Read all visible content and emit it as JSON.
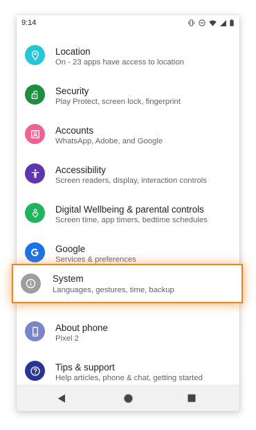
{
  "status_bar": {
    "time": "9:14",
    "icons": [
      "vibrate-icon",
      "do-not-disturb-icon",
      "wifi-icon",
      "signal-icon",
      "battery-icon"
    ]
  },
  "settings": {
    "items": [
      {
        "title": "Location",
        "subtitle": "On - 23 apps have access to location",
        "icon": "location-pin-icon",
        "color": "#26c6da"
      },
      {
        "title": "Security",
        "subtitle": "Play Protect, screen lock, fingerprint",
        "icon": "unlocked-padlock-icon",
        "color": "#1e8e3e"
      },
      {
        "title": "Accounts",
        "subtitle": "WhatsApp, Adobe, and Google",
        "icon": "account-box-icon",
        "color": "#f06292"
      },
      {
        "title": "Accessibility",
        "subtitle": "Screen readers, display, interaction controls",
        "icon": "accessibility-person-icon",
        "color": "#5e35b1"
      },
      {
        "title": "Digital Wellbeing & parental controls",
        "subtitle": "Screen time, app timers, bedtime schedules",
        "icon": "wellbeing-heart-icon",
        "color": "#1fb55a"
      },
      {
        "title": "Google",
        "subtitle": "Services & preferences",
        "icon": "google-g-icon",
        "color": "#1a73e8"
      },
      {
        "title": "System",
        "subtitle": "Languages, gestures, time, backup",
        "icon": "info-icon",
        "color": "#9e9e9e"
      },
      {
        "title": "About phone",
        "subtitle": "Pixel 2",
        "icon": "phone-icon",
        "color": "#7986cb"
      },
      {
        "title": "Tips & support",
        "subtitle": "Help articles, phone & chat, getting started",
        "icon": "help-question-icon",
        "color": "#283593"
      }
    ]
  },
  "nav_bar": {
    "buttons": [
      "back-triangle-icon",
      "home-circle-icon",
      "recents-square-icon"
    ]
  },
  "colors": {
    "highlight_border": "#f58220",
    "title_text": "#202124",
    "subtitle_text": "#5f6368",
    "nav_background": "#f1f1f1"
  }
}
